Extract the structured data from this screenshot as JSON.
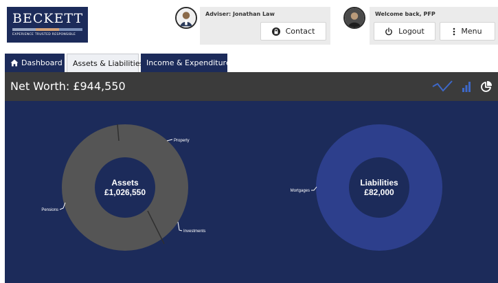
{
  "brand": {
    "name": "BECKETT",
    "tagline": "EXPERIENCE   TRUSTED   RESPONSIBLE",
    "colors": {
      "navy": "#1c2b5a",
      "bar1": "#9aa7c2",
      "bar2": "#d2a27a",
      "bar3": "#7a8fb8"
    }
  },
  "adviser": {
    "label": "Adviser: Jonathan Law",
    "contact_label": "Contact",
    "icon": "lock-icon"
  },
  "user": {
    "welcome": "Welcome back, PFP",
    "logout_label": "Logout",
    "menu_label": "Menu",
    "logout_icon": "power-icon",
    "menu_icon": "vertical-dots-icon"
  },
  "tabs": [
    {
      "label": "Dashboard",
      "icon": "home-icon",
      "active": false
    },
    {
      "label": "Assets & Liabilities",
      "active": true
    },
    {
      "label": "Income & Expenditure",
      "active": false
    }
  ],
  "net_worth": {
    "label": "Net Worth: £944,550",
    "view_icons": [
      "line-chart-icon",
      "bar-chart-icon",
      "pie-chart-icon"
    ]
  },
  "assets": {
    "title": "Assets",
    "total": "£1,026,550",
    "segments": [
      {
        "label": "Property",
        "value": 0.35,
        "color": "#555555"
      },
      {
        "label": "Investments",
        "value": 0.0,
        "color": "#555555"
      },
      {
        "label": "Pensions",
        "value": 0.65,
        "color": "#555555"
      }
    ],
    "slice_labels": [
      "Property",
      "Investments",
      "Pensions"
    ]
  },
  "liabilities": {
    "title": "Liabilities",
    "total": "£82,000",
    "segments": [
      {
        "label": "Mortgages",
        "value": 1.0,
        "color": "#2d3f8c"
      }
    ]
  },
  "colors": {
    "chart_bg": "#1c2b5a",
    "asset_ring": "#555555",
    "liability_ring": "#2d3f8c",
    "accent_icons": "#3d68c9"
  }
}
